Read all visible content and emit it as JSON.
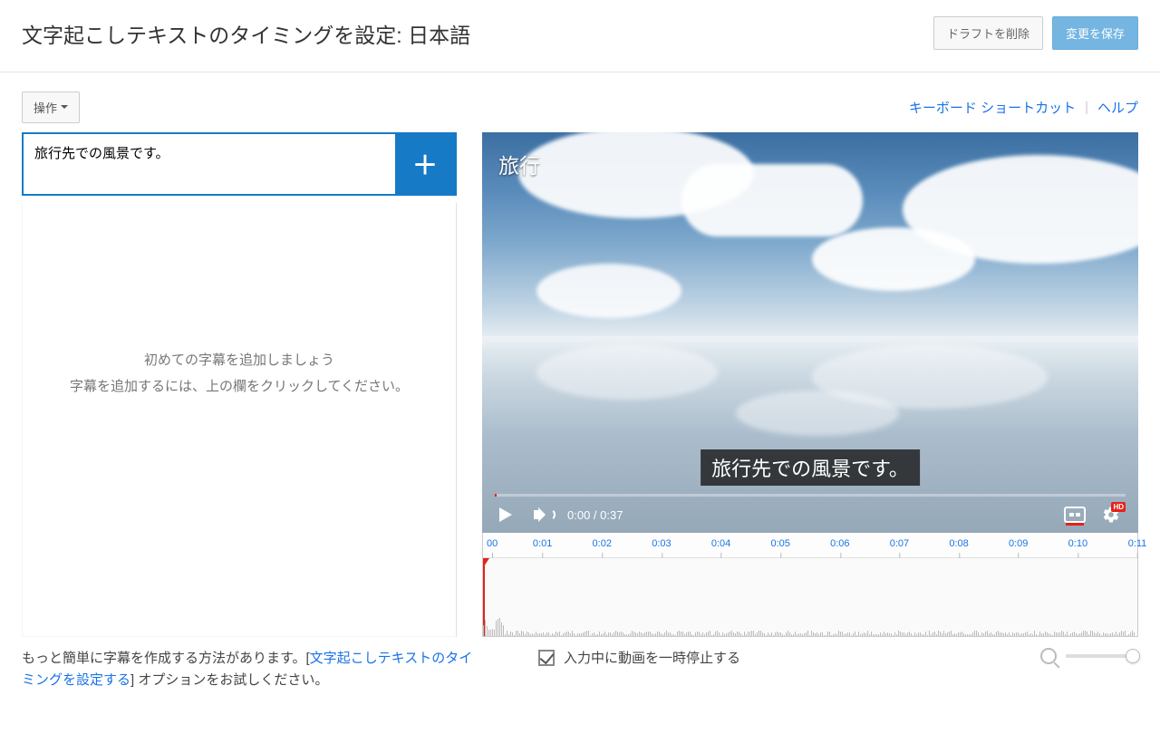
{
  "header": {
    "title": "文字起こしテキストのタイミングを設定: 日本語",
    "delete_draft": "ドラフトを削除",
    "save_changes": "変更を保存"
  },
  "left": {
    "actions_label": "操作",
    "caption_input_value": "旅行先での風景です。",
    "empty_line1": "初めての字幕を追加しましょう",
    "empty_line2": "字幕を追加するには、上の欄をクリックしてください。"
  },
  "right": {
    "keyboard_shortcuts": "キーボード ショートカット",
    "help": "ヘルプ"
  },
  "video": {
    "title_overlay": "旅行",
    "caption_overlay": "旅行先での風景です。",
    "time_current": "0:00",
    "time_sep": " / ",
    "time_total": "0:37",
    "hd_label": "HD"
  },
  "timeline": {
    "ticks": [
      "00",
      "0:01",
      "0:02",
      "0:03",
      "0:04",
      "0:05",
      "0:06",
      "0:07",
      "0:08",
      "0:09",
      "0:10",
      "0:11"
    ]
  },
  "footer": {
    "tip_prefix": "もっと簡単に字幕を作成する方法があります。[",
    "tip_link": "文字起こしテキストのタイミングを設定する",
    "tip_suffix": "] オプションをお試しください。",
    "pause_checkbox_label": "入力中に動画を一時停止する",
    "pause_checked": true
  }
}
